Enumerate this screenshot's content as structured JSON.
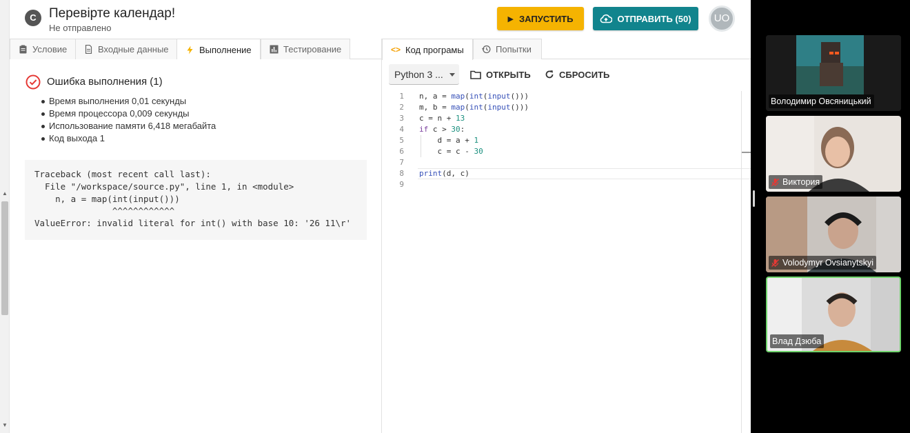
{
  "header": {
    "logo_letter": "C",
    "title": "Перевірте календар!",
    "subtitle": "Не отправлено",
    "run_label": "ЗАПУСТИТЬ",
    "send_label": "ОТПРАВИТЬ (50)",
    "avatar_initials": "UO"
  },
  "left_tabs": [
    {
      "label": "Условие",
      "icon": "clipboard-icon"
    },
    {
      "label": "Входные данные",
      "icon": "document-icon"
    },
    {
      "label": "Выполнение",
      "icon": "lightning-icon",
      "active": true
    },
    {
      "label": "Тестирование",
      "icon": "bar-chart-icon"
    }
  ],
  "result": {
    "title": "Ошибка выполнения (1)",
    "stats": [
      "Время выполнения 0,01 секунды",
      "Время процессора 0,009 секунды",
      "Использование памяти 6,418 мегабайта",
      "Код выхода 1"
    ],
    "traceback": "Traceback (most recent call last):\n  File \"/workspace/source.py\", line 1, in <module>\n    n, a = map(int(input()))\n               ^^^^^^^^^^^^\nValueError: invalid literal for int() with base 10: '26 11\\r'"
  },
  "right_tabs": [
    {
      "label": "Код програмы",
      "icon": "code-icon",
      "active": true
    },
    {
      "label": "Попытки",
      "icon": "history-icon"
    }
  ],
  "toolbar": {
    "language": "Python 3 ...",
    "open_label": "ОТКРЫТЬ",
    "reset_label": "СБРОСИТЬ"
  },
  "editor": {
    "line_numbers": [
      "1",
      "2",
      "3",
      "4",
      "5",
      "6",
      "7",
      "8",
      "9"
    ]
  },
  "participants": [
    {
      "name": "Володимир Овсяницький",
      "muted": false
    },
    {
      "name": "Виктория",
      "muted": true
    },
    {
      "name": "Volodymyr Ovsianytskyi",
      "muted": true
    },
    {
      "name": "Влад Дзюба",
      "muted": false,
      "active": true
    }
  ],
  "colors": {
    "run_button": "#f5b301",
    "send_button": "#11848d",
    "error_red": "#e53935",
    "active_speaker": "#6fd46c",
    "keyword": "#7a3e9d",
    "function": "#3650b8",
    "number": "#1a8f7e"
  }
}
